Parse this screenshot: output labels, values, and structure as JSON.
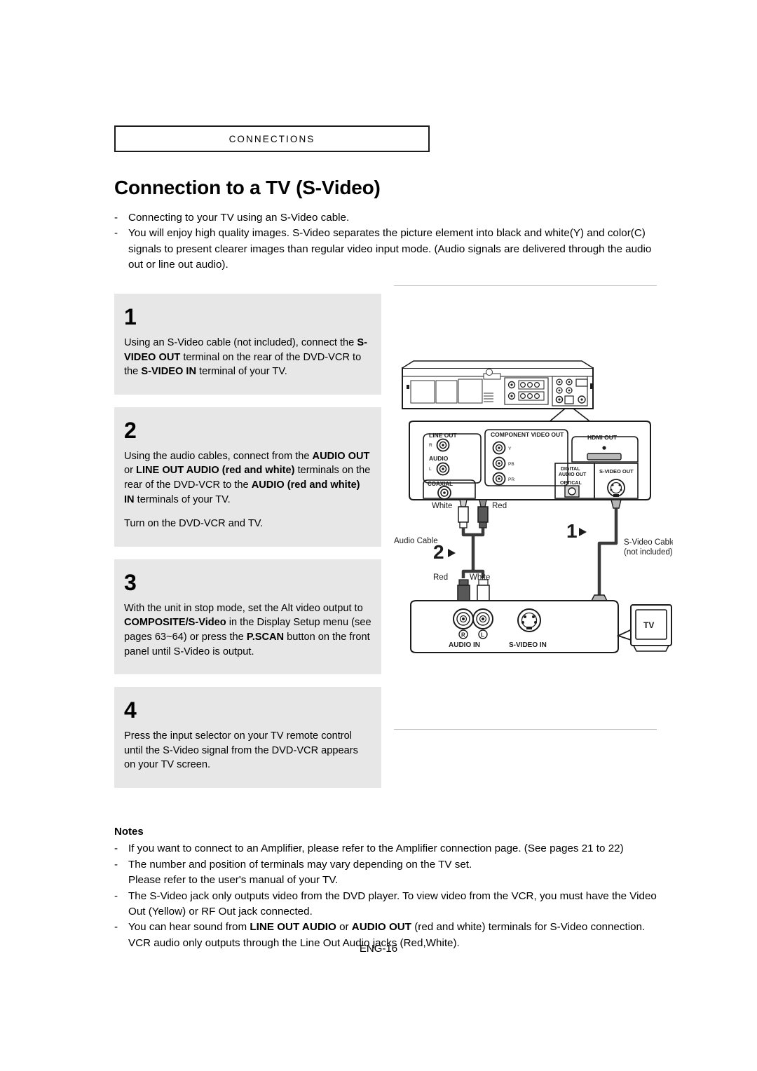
{
  "header": {
    "chapter": "CONNECTIONS",
    "title": "Connection to a TV (S-Video)"
  },
  "intro": {
    "bullets": [
      "Connecting to your TV using an S-Video cable.",
      "You will enjoy high quality images. S-Video separates the picture element into black and white(Y) and color(C) signals to present clearer images than regular video input mode. (Audio signals are delivered through the audio out or line out audio)."
    ]
  },
  "steps": [
    {
      "number": "1",
      "paragraphs": [
        "Using an S-Video cable (not included), connect the <b>S-VIDEO OUT</b> terminal on the rear of the DVD-VCR to the <b>S-VIDEO IN</b> terminal of your TV."
      ]
    },
    {
      "number": "2",
      "paragraphs": [
        "Using the audio cables, connect from the <b>AUDIO OUT</b> or <b>LINE OUT AUDIO (red and white)</b> terminals on the rear of the DVD-VCR to the <b>AUDIO (red and white) IN</b> terminals of your TV.",
        "Turn on the DVD-VCR and TV."
      ]
    },
    {
      "number": "3",
      "paragraphs": [
        "With the unit in stop mode, set the Alt video output to <b>COMPOSITE/S-Video</b> in the Display Setup menu (see pages 63~64) or press the <b>P.SCAN</b> button on the front panel until S-Video is output."
      ]
    },
    {
      "number": "4",
      "paragraphs": [
        "Press the input selector on your TV remote control until the S-Video signal from the DVD-VCR appears on your TV screen."
      ]
    }
  ],
  "diagram": {
    "rear_panel_labels": {
      "line_out": "LINE OUT",
      "audio": "AUDIO",
      "audio_r": "R",
      "audio_l": "L",
      "coaxial": "COAXIAL",
      "component_video_out": "COMPONENT VIDEO OUT",
      "component_y": "Y",
      "component_pb": "PB",
      "component_pr": "PR",
      "hdmi_out": "HDMI OUT",
      "digital_audio_out": "DIGITAL AUDIO OUT",
      "optical": "OPTICAL",
      "s_video_out": "S-VIDEO OUT"
    },
    "cables": {
      "top_white": "White",
      "top_red": "Red",
      "bottom_red": "Red",
      "bottom_white": "White",
      "audio_cable": "Audio Cable",
      "s_video_cable_line1": "S-Video Cable",
      "s_video_cable_line2": "(not included)",
      "marker_1": "1",
      "marker_2": "2"
    },
    "tv_panel_labels": {
      "audio_in": "AUDIO IN",
      "jack_r": "R",
      "jack_l": "L",
      "s_video_in": "S-VIDEO IN",
      "tv": "TV"
    },
    "colors": {
      "red_plug": "#585858",
      "white_plug": "#ffffff",
      "cable": "#3a3a3a",
      "panel_fill": "#ffffff",
      "box_fill": "#e7e7e7"
    }
  },
  "notes": {
    "title": "Notes",
    "bullets": [
      "If you want to connect to an Amplifier, please refer to the Amplifier connection page. (See pages 21 to 22)",
      "The number and position of terminals may vary depending on the TV set.<br>Please refer to the user's manual of your TV.",
      "The S-Video jack only outputs video from the DVD player. To view video from the VCR, you must have the Video Out (Yellow) or RF Out jack connected.",
      "You can hear sound from <b>LINE OUT AUDIO</b> or <b>AUDIO OUT</b> (red and white) terminals for S-Video connection. VCR audio only outputs through the Line Out Audio jacks (Red,White)."
    ]
  },
  "footer": {
    "page": "ENG-16"
  }
}
